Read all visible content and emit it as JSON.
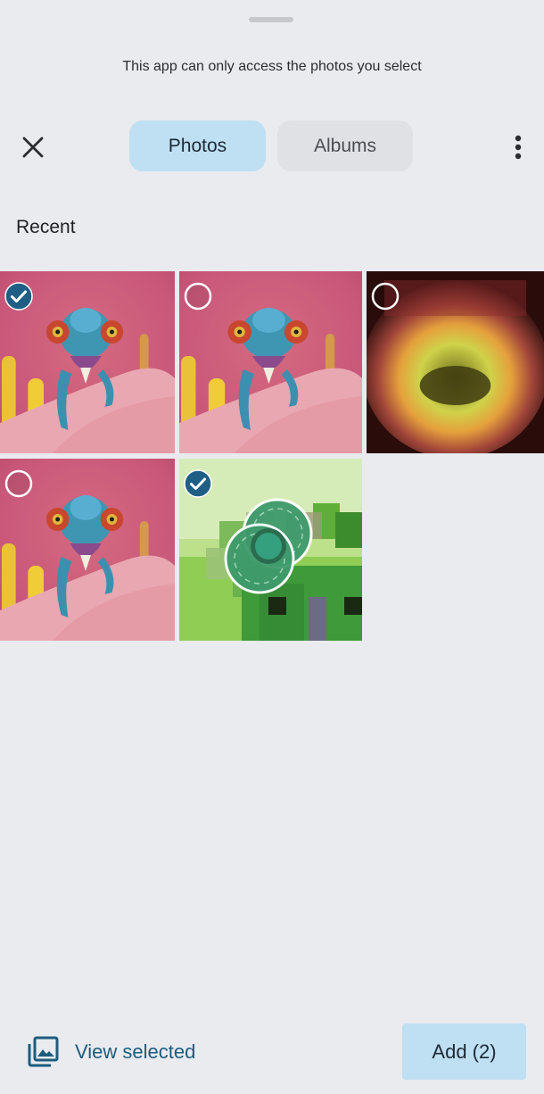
{
  "header": {
    "notice": "This app can only access the photos you select",
    "close_icon": "close-icon",
    "more_icon": "more-vert-icon"
  },
  "tabs": [
    {
      "label": "Photos",
      "active": true
    },
    {
      "label": "Albums",
      "active": false
    }
  ],
  "section": {
    "title": "Recent"
  },
  "photos": [
    {
      "kind": "chameleon",
      "selected": true
    },
    {
      "kind": "chameleon",
      "selected": false
    },
    {
      "kind": "blur-glow",
      "selected": false
    },
    {
      "kind": "chameleon",
      "selected": false
    },
    {
      "kind": "green-pixel",
      "selected": true
    }
  ],
  "footer": {
    "view_selected_label": "View selected",
    "view_selected_icon": "photo-library-icon",
    "add_label": "Add (2)"
  },
  "colors": {
    "background": "#e9ebef",
    "accent": "#bfdff3",
    "accent_text": "#1c5c7f",
    "check_fill": "#1f5f86"
  }
}
